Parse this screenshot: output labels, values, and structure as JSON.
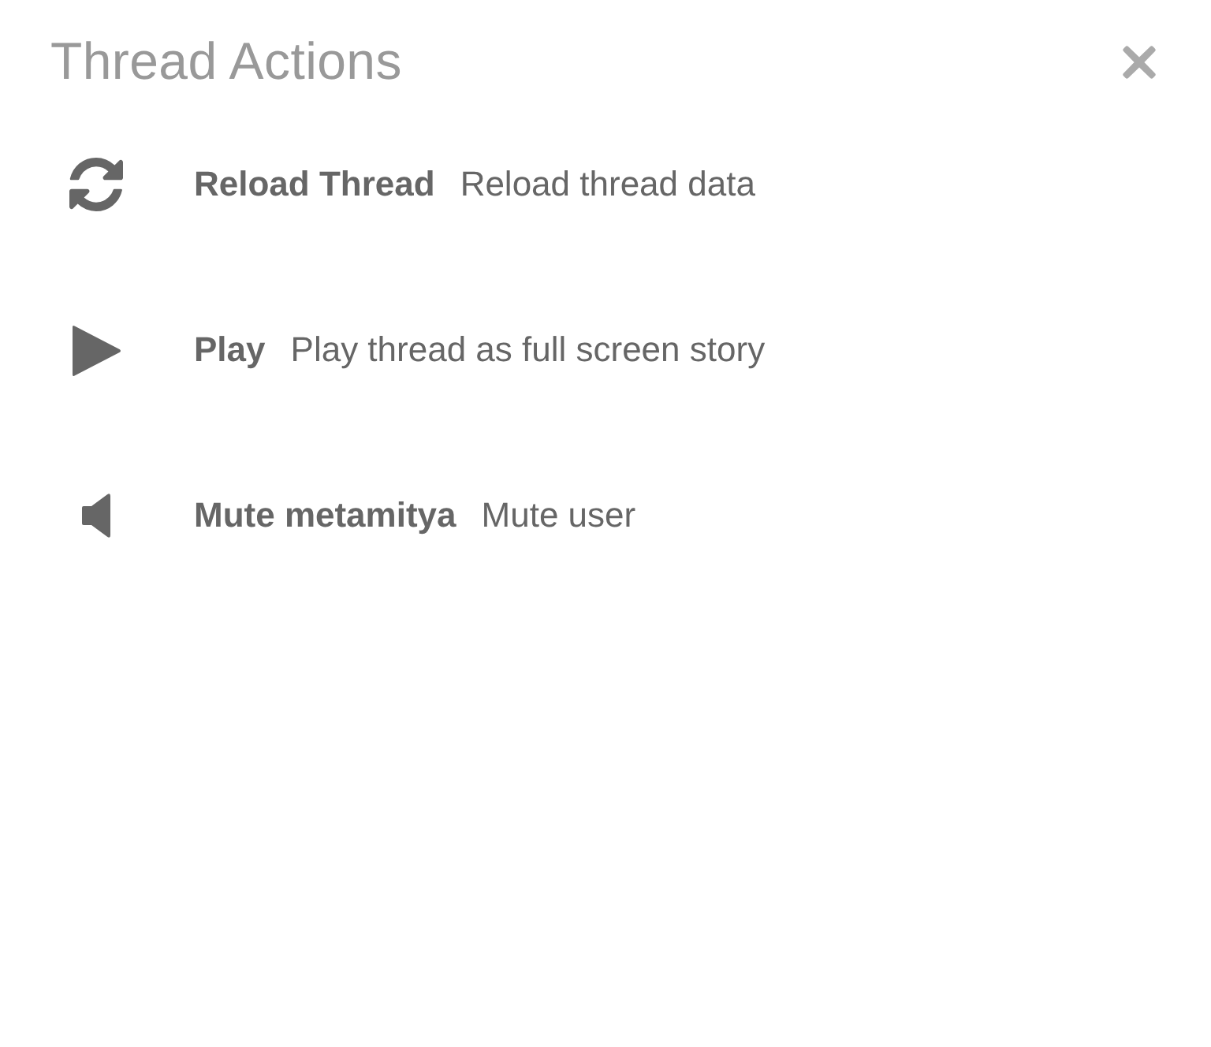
{
  "dialog": {
    "title": "Thread Actions"
  },
  "actions": [
    {
      "kind": "reload",
      "label": "Reload Thread",
      "description": "Reload thread data"
    },
    {
      "kind": "play",
      "label": "Play",
      "description": "Play thread as full screen story"
    },
    {
      "kind": "mute",
      "label": "Mute metamitya",
      "description": "Mute user"
    }
  ]
}
